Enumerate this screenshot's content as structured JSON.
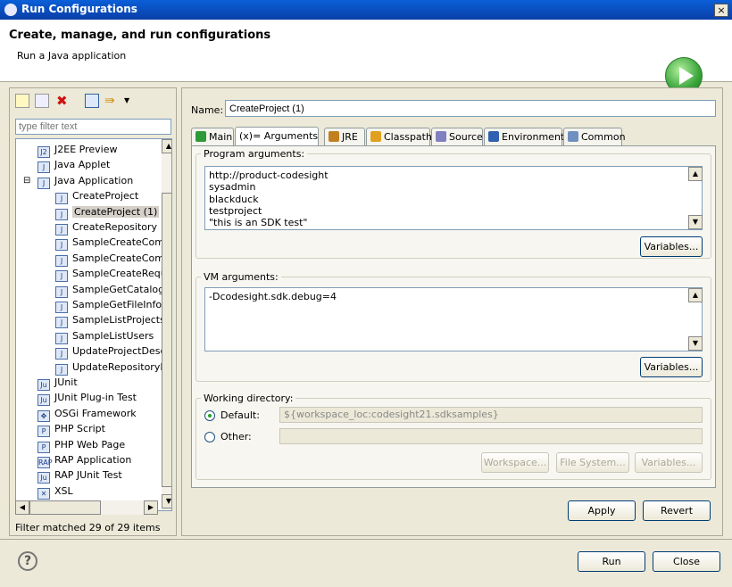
{
  "window": {
    "title": "Run Configurations",
    "close": "×"
  },
  "header": {
    "title": "Create, manage, and run configurations",
    "subtitle": "Run a Java application"
  },
  "left": {
    "filter_placeholder": "type filter text",
    "tree": [
      {
        "label": "J2EE Preview",
        "level": 1,
        "icon": "J2"
      },
      {
        "label": "Java Applet",
        "level": 1,
        "icon": "J"
      },
      {
        "label": "Java Application",
        "level": 1,
        "icon": "J",
        "expanded": true
      },
      {
        "label": "CreateProject",
        "level": 2,
        "icon": "J"
      },
      {
        "label": "CreateProject (1)",
        "level": 2,
        "icon": "J",
        "selected": true
      },
      {
        "label": "CreateRepository",
        "level": 2,
        "icon": "J"
      },
      {
        "label": "SampleCreateComp",
        "level": 2,
        "icon": "J"
      },
      {
        "label": "SampleCreateComp",
        "level": 2,
        "icon": "J"
      },
      {
        "label": "SampleCreateReque",
        "level": 2,
        "icon": "J"
      },
      {
        "label": "SampleGetCatalogC",
        "level": 2,
        "icon": "J"
      },
      {
        "label": "SampleGetFileInfo",
        "level": 2,
        "icon": "J"
      },
      {
        "label": "SampleListProjects",
        "level": 2,
        "icon": "J"
      },
      {
        "label": "SampleListUsers",
        "level": 2,
        "icon": "J"
      },
      {
        "label": "UpdateProjectDescr",
        "level": 2,
        "icon": "J"
      },
      {
        "label": "UpdateRepositoryN",
        "level": 2,
        "icon": "J"
      },
      {
        "label": "JUnit",
        "level": 1,
        "icon": "Ju"
      },
      {
        "label": "JUnit Plug-in Test",
        "level": 1,
        "icon": "Ju"
      },
      {
        "label": "OSGi Framework",
        "level": 1,
        "icon": "✥"
      },
      {
        "label": "PHP Script",
        "level": 1,
        "icon": "P"
      },
      {
        "label": "PHP Web Page",
        "level": 1,
        "icon": "P"
      },
      {
        "label": "RAP Application",
        "level": 1,
        "icon": "RAP"
      },
      {
        "label": "RAP JUnit Test",
        "level": 1,
        "icon": "Ju"
      },
      {
        "label": "XSL",
        "level": 1,
        "icon": "✕"
      }
    ],
    "status": "Filter matched 29 of 29 items"
  },
  "right": {
    "name_label": "Name:",
    "name_value": "CreateProject (1)",
    "tabs": [
      {
        "label": "Main",
        "color": "#2e9a3a"
      },
      {
        "label": "(x)= Arguments",
        "active": true,
        "color": ""
      },
      {
        "label": "JRE",
        "color": "#c08020"
      },
      {
        "label": "Classpath",
        "color": "#e0a020"
      },
      {
        "label": "Source",
        "color": "#8080c0"
      },
      {
        "label": "Environment",
        "color": "#3060b0"
      },
      {
        "label": "Common",
        "color": "#7090c0"
      }
    ],
    "program_args_label": "Program arguments:",
    "program_args": "http://product-codesight\nsysadmin\nblackduck\ntestproject\n\"this is an SDK test\"",
    "vm_args_label": "VM arguments:",
    "vm_args": "-Dcodesight.sdk.debug=4",
    "variables": "Variables...",
    "workdir_label": "Working directory:",
    "default_label": "Default:",
    "default_value": "${workspace_loc:codesight21.sdksamples}",
    "other_label": "Other:",
    "other_value": "",
    "workspace": "Workspace...",
    "filesystem": "File System...",
    "apply": "Apply",
    "revert": "Revert"
  },
  "footer": {
    "help": "?",
    "run": "Run",
    "close": "Close"
  }
}
